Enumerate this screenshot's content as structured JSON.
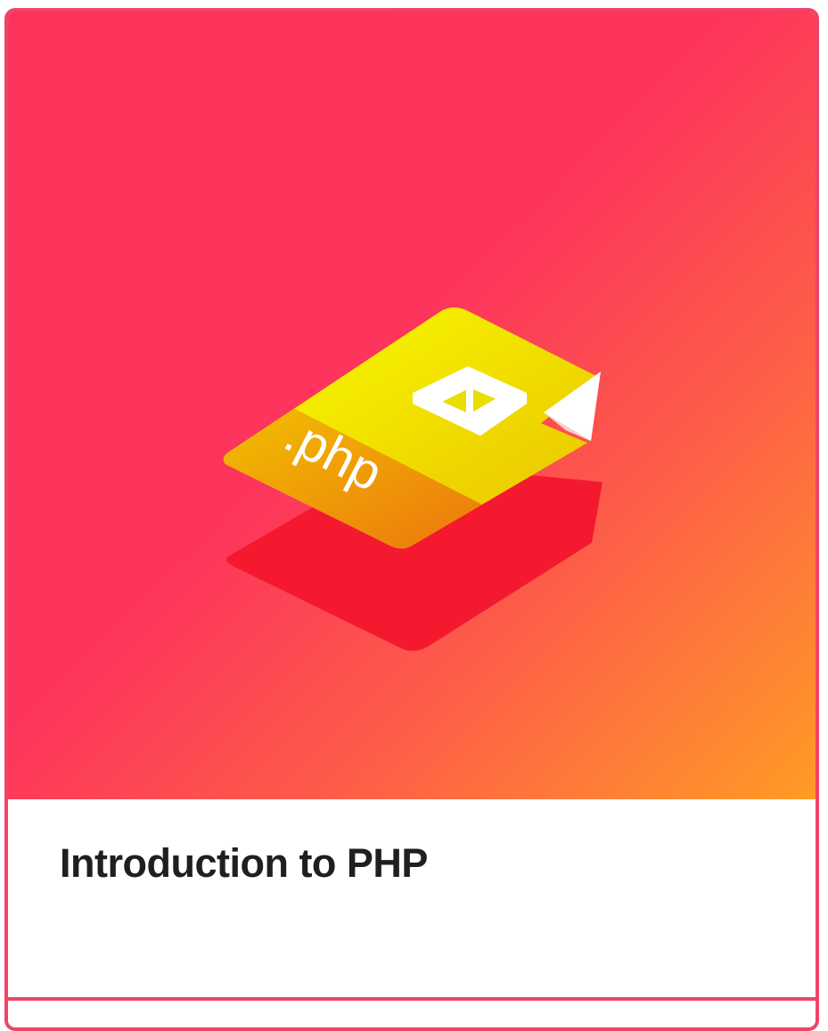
{
  "course_card": {
    "title": "Introduction to PHP",
    "thumbnail": {
      "file_label": ".php",
      "icon": "php-file-cube-icon"
    }
  },
  "colors": {
    "border": "#ef4466",
    "gradient_start": "#fc345c",
    "gradient_end": "#ff9c24",
    "file_yellow": "#f7e600",
    "file_shadow": "#f4192f",
    "title_text": "#1f1f1f"
  }
}
